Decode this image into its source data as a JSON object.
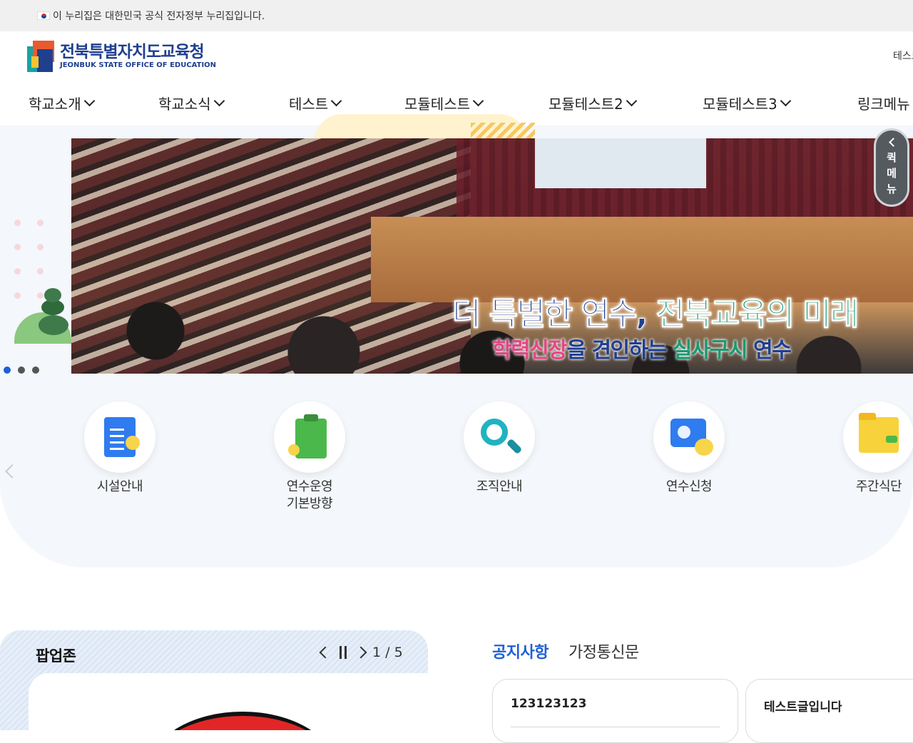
{
  "gov_banner": {
    "text": "이 누리집은 대한민국 공식 전자정부 누리집입니다.",
    "icon": "korea-flag-icon"
  },
  "header": {
    "logo_kr": "전북특별자치도교육청",
    "logo_en": "JEONBUK STATE OFFICE OF EDUCATION",
    "util_link": "테스트"
  },
  "gnb": {
    "items": [
      {
        "label": "학교소개"
      },
      {
        "label": "학교소식"
      },
      {
        "label": "테스트"
      },
      {
        "label": "모듈테스트"
      },
      {
        "label": "모듈테스트2"
      },
      {
        "label": "모듈테스트3"
      },
      {
        "label": "링크메뉴"
      }
    ]
  },
  "main_visual": {
    "title_part1": "더 특별한 연수, ",
    "title_part2": "전북교육의 미래",
    "sub_part1": "학력신장",
    "sub_part2": "을 견인하는 ",
    "sub_part3": "실사구시",
    "sub_part4": " 연수",
    "slide_count": 3,
    "active_slide": 1
  },
  "quick_menu": {
    "label_1": "퀵",
    "label_2": "메",
    "label_3": "뉴"
  },
  "shortcuts": [
    {
      "label": "시설안내",
      "icon": "document-icon"
    },
    {
      "label": "연수운영 기본방향",
      "line1": "연수운영",
      "line2": "기본방향",
      "icon": "clipboard-icon"
    },
    {
      "label": "조직안내",
      "icon": "search-icon"
    },
    {
      "label": "연수신청",
      "icon": "chart-icon"
    },
    {
      "label": "주간식단",
      "icon": "folder-icon"
    }
  ],
  "popup_zone": {
    "title": "팝업존",
    "counter": "1 / 5"
  },
  "notice": {
    "tabs": [
      {
        "label": "공지사항",
        "active": true
      },
      {
        "label": "가정통신문",
        "active": false
      }
    ],
    "cards": [
      {
        "title": "123123123"
      },
      {
        "title": "테스트글입니다"
      }
    ]
  },
  "colors": {
    "brand_blue": "#1f3f8f",
    "accent_blue": "#1f5fd6",
    "green": "#1a9a72",
    "pink": "#e64585"
  }
}
